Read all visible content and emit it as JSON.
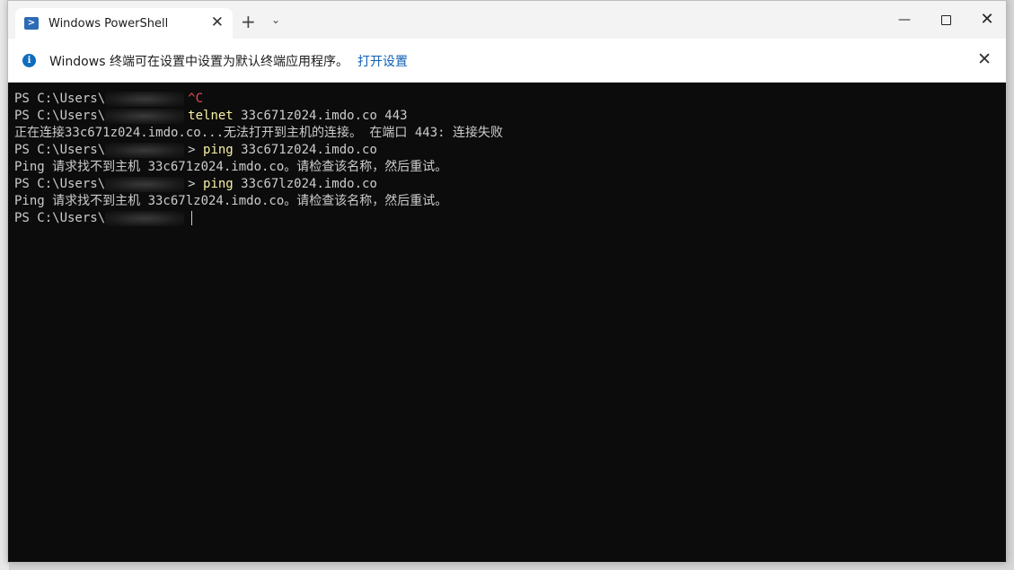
{
  "window": {
    "tab_title": "Windows PowerShell",
    "tab_close": "✕",
    "new_tab": "+",
    "dropdown": "⌄",
    "minimize": "—",
    "close": "✕"
  },
  "infobar": {
    "icon": "i",
    "message": "Windows 终端可在设置中设置为默认终端应用程序。",
    "link": "打开设置",
    "close": "✕"
  },
  "terminal": {
    "lines": [
      {
        "prompt": "PS C:\\Users\\",
        "suffix": "",
        "cmd": "",
        "args": "^C",
        "args_style": "err"
      },
      {
        "prompt": "PS C:\\Users\\",
        "suffix": "",
        "cmd": "telnet",
        "args": " 33c671z024.imdo.co 443"
      },
      {
        "text": "正在连接33c671z024.imdo.co...无法打开到主机的连接。 在端口 443: 连接失败"
      },
      {
        "prompt": "PS C:\\Users\\",
        "suffix": "> ",
        "cmd": "ping",
        "args": " 33c671z024.imdo.co"
      },
      {
        "text": "Ping 请求找不到主机 33c671z024.imdo.co。请检查该名称，然后重试。"
      },
      {
        "prompt": "PS C:\\Users\\",
        "suffix": "> ",
        "cmd": "ping",
        "args": " 33c67lz024.imdo.co"
      },
      {
        "text": "Ping 请求找不到主机 33c67lz024.imdo.co。请检查该名称，然后重试。"
      },
      {
        "prompt": "PS C:\\Users\\",
        "suffix": "",
        "cmd": "",
        "args": ""
      }
    ]
  },
  "colors": {
    "terminal_bg": "#0c0c0c",
    "command": "#f9f1a5",
    "error": "#e74856",
    "link": "#0f5fb3",
    "info_icon": "#0f6cbd"
  }
}
